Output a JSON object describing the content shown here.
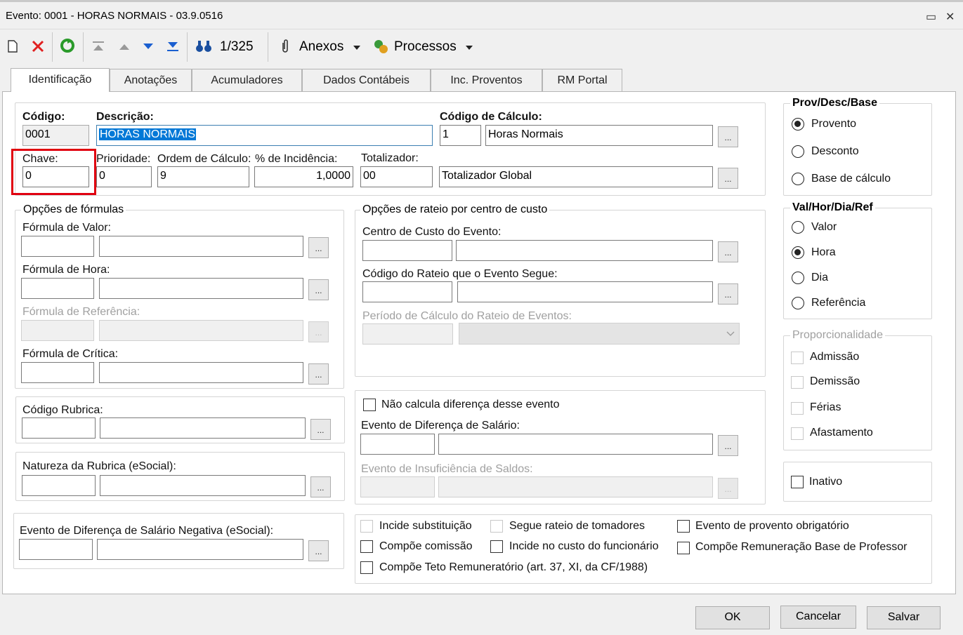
{
  "window": {
    "title": "Evento: 0001 - HORAS NORMAIS - 03.9.0516",
    "restore_glyph": "▭",
    "close_glyph": "✕"
  },
  "toolbar": {
    "record_counter": "1/325",
    "anexos": "Anexos",
    "processos": "Processos"
  },
  "tabs": [
    "Identificação",
    "Anotações",
    "Acumuladores",
    "Dados Contábeis",
    "Inc. Proventos",
    "RM Portal"
  ],
  "ident": {
    "codigo_label": "Código:",
    "codigo_value": "0001",
    "descricao_label": "Descrição:",
    "descricao_value": "HORAS NORMAIS",
    "codcalc_label": "Código de Cálculo:",
    "codcalc_value": "1",
    "codcalc_desc": "Horas Normais",
    "chave_label": "Chave:",
    "chave_value": "0",
    "prioridade_label": "Prioridade:",
    "prioridade_value": "0",
    "ordem_label": "Ordem de Cálculo:",
    "ordem_value": "9",
    "incidencia_label": "% de Incidência:",
    "incidencia_value": "1,0000",
    "totalizador_label": "Totalizador:",
    "totalizador_value": "00",
    "totalizador_desc": "Totalizador Global"
  },
  "ellipsis": "...",
  "formulas": {
    "legend": "Opções de fórmulas",
    "valor": "Fórmula de Valor:",
    "hora": "Fórmula de Hora:",
    "referencia": "Fórmula de Referência:",
    "critica": "Fórmula de Crítica:"
  },
  "rubrica": {
    "codigo": "Código Rubrica:",
    "natureza": "Natureza da Rubrica (eSocial):",
    "negativa": "Evento de Diferença de Salário Negativa (eSocial):"
  },
  "rateio": {
    "legend": "Opções de rateio por centro de custo",
    "centro": "Centro de Custo do Evento:",
    "codigo": "Código do Rateio que o Evento Segue:",
    "periodo": "Período de Cálculo do Rateio de Eventos:"
  },
  "diferenca": {
    "nao_calcula": "Não calcula diferença desse evento",
    "evento_dif": "Evento de Diferença de Salário:",
    "insuficiencia": "Evento de Insuficiência de Saldos:"
  },
  "checks": {
    "incide_subst": "Incide substituição",
    "segue_rateio": "Segue rateio de tomadores",
    "prov_obrig": "Evento de provento obrigatório",
    "compoe_comissao": "Compõe comissão",
    "incide_custo": "Incide no custo do funcionário",
    "compoe_rem_prof": "Compõe Remuneração Base de Professor",
    "compoe_teto": "Compõe Teto Remuneratório (art. 37, XI, da CF/1988)"
  },
  "prov": {
    "legend": "Prov/Desc/Base",
    "options": [
      "Provento",
      "Desconto",
      "Base de cálculo"
    ],
    "selected": "Provento"
  },
  "valhor": {
    "legend": "Val/Hor/Dia/Ref",
    "options": [
      "Valor",
      "Hora",
      "Dia",
      "Referência"
    ],
    "selected": "Hora"
  },
  "proporc": {
    "legend": "Proporcionalidade",
    "options": [
      "Admissão",
      "Demissão",
      "Férias",
      "Afastamento"
    ]
  },
  "inativo": "Inativo",
  "buttons": {
    "ok": "OK",
    "cancel": "Cancelar",
    "save": "Salvar"
  },
  "colors": {
    "highlight": "#0078d7",
    "red_marker": "#e0000f"
  }
}
